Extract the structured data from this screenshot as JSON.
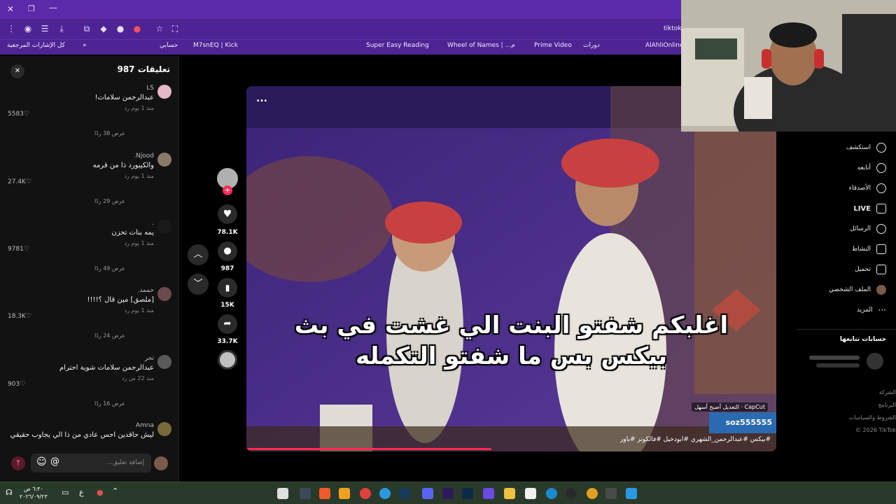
{
  "browser": {
    "url_fragment": "tiktok",
    "bookmarks": [
      "كل الإشارات المرجعية",
      "حسابي",
      "M7snEQ | Kick",
      "Super Easy Reading",
      "Wheel of Names | ...م",
      "Prime Video",
      "دورات",
      "AlAhliOnline"
    ]
  },
  "comments_panel": {
    "title": "تعليقات 987",
    "close_label": "✕",
    "input_placeholder": "إضافة تعليق...",
    "items": [
      {
        "name": "LS",
        "text": "عبدالرحمن سلامات!",
        "time": "منذ 1 يوم",
        "reply": "رد",
        "likes": "5583",
        "more": "عرض 38 ردًا"
      },
      {
        "name": "Njood.",
        "text": "والكيبورد ذا من قرمه",
        "time": "منذ 1 يوم",
        "reply": "رد",
        "likes": "27.4K",
        "more": "عرض 29 ردًا"
      },
      {
        "name": ".",
        "text": "يمه بنات تحزن",
        "time": "منذ 1 يوم",
        "reply": "رد",
        "likes": "9781",
        "more": "عرض 49 ردًا"
      },
      {
        "name": "حممد.",
        "text": "[ملصق] مين قال ؟!!!!",
        "time": "منذ 1 يوم",
        "reply": "رد",
        "likes": "18.3K",
        "more": "عرض 24 ردًا"
      },
      {
        "name": "تحر",
        "text": "عبدالرحمن سلامات شوية احترام",
        "time": "منذ 22 س",
        "reply": "رد",
        "likes": "903",
        "more": "عرض 16 ردًا"
      },
      {
        "name": "Amna",
        "text": "ليش حاقدين احس عادي من ذا الي يجاوب حقيقي",
        "time": "",
        "reply": "",
        "likes": "",
        "more": ""
      }
    ]
  },
  "actions": {
    "likes": "78.1K",
    "comments": "987",
    "saves": "15K",
    "shares": "33.7K"
  },
  "video": {
    "subtitle_line1": "اغلبكم شفتو البنت الي غشت في بث",
    "subtitle_line2": "بيكس بس ما شفتو التكمله",
    "more_label": "...",
    "capcut_label": "CapCut · التعديل أصبح أسهل",
    "creator": "soz555555",
    "hashtags": "#بيكس #عبدالرحمن_الشهري #ابودخيل #فالكونز #باور"
  },
  "sidebar": {
    "nav": [
      "استكشف",
      "أتابعه",
      "الأصدقاء",
      "LIVE",
      "الرسائل",
      "النشاط",
      "تحميل",
      "الملف الشخصي",
      "المزيد"
    ],
    "following_title": "حسابات تتابعها",
    "footer": [
      "الشركة",
      "البرنامج",
      "الشروط والسياسات",
      "© 2026 TikTok"
    ]
  },
  "taskbar": {
    "time": "٦:٣٠ ص",
    "date": "٢٠٢٦/٠٩/٢٣",
    "lang": "ع"
  }
}
